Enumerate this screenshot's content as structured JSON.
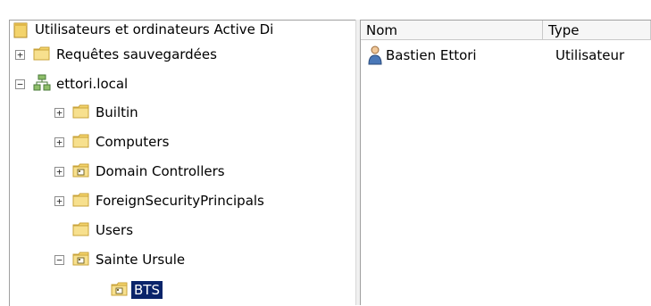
{
  "tree": {
    "root": {
      "label": "Utilisateurs et ordinateurs Active Di",
      "icon": "snapin-root-icon"
    },
    "items": [
      {
        "label": "Requêtes sauvegardées",
        "expander": "+",
        "icon": "folder-icon"
      },
      {
        "label": "ettori.local",
        "expander": "−",
        "icon": "domain-icon"
      },
      {
        "label": "Builtin",
        "expander": "+",
        "icon": "folder-icon"
      },
      {
        "label": "Computers",
        "expander": "+",
        "icon": "folder-icon"
      },
      {
        "label": "Domain Controllers",
        "expander": "+",
        "icon": "ou-folder-icon"
      },
      {
        "label": "ForeignSecurityPrincipals",
        "expander": "+",
        "icon": "folder-icon"
      },
      {
        "label": "Users",
        "expander": "",
        "icon": "folder-icon"
      },
      {
        "label": "Sainte Ursule",
        "expander": "−",
        "icon": "ou-folder-icon"
      },
      {
        "label": "BTS",
        "expander": "",
        "icon": "ou-folder-icon",
        "selected": true
      }
    ]
  },
  "list": {
    "columns": [
      "Nom",
      "Type"
    ],
    "rows": [
      {
        "name": "Bastien Ettori",
        "type": "Utilisateur",
        "icon": "user-icon"
      }
    ]
  },
  "colors": {
    "folder": "#f3d36b",
    "selection": "#0a246a"
  }
}
